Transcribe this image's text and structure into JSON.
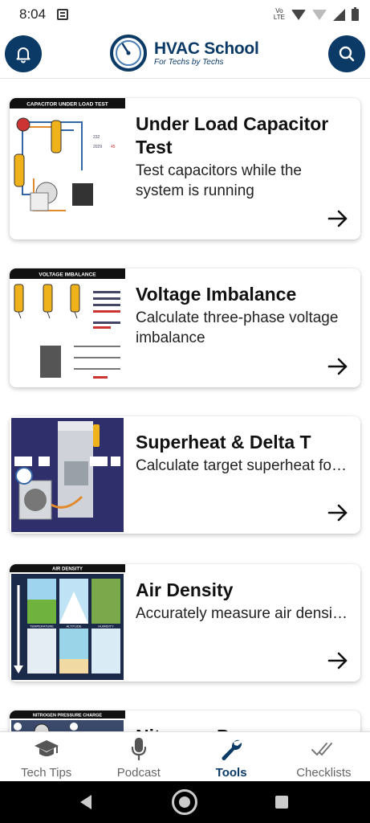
{
  "status_bar": {
    "time": "8:04",
    "network_top": "Vo",
    "network_bottom": "LTE"
  },
  "header": {
    "logo_title": "HVAC School",
    "logo_subtitle": "For Techs by Techs",
    "left_icon": "bell-icon",
    "right_icon": "search-icon",
    "brand_color": "#0b3a66"
  },
  "tools": [
    {
      "thumb_label": "CAPACITOR UNDER LOAD TEST",
      "title": "Under Load Capacitor Test",
      "description": "Test capacitors while the system is running"
    },
    {
      "thumb_label": "VOLTAGE IMBALANCE",
      "title": "Voltage Imbalance",
      "description": "Calculate three-phase voltage imbalance"
    },
    {
      "thumb_label": "",
      "title": "Superheat & Delta T",
      "description": "Calculate target superheat for fixed metering device (…"
    },
    {
      "thumb_label": "AIR DENSITY",
      "title": "Air Density",
      "description": "Accurately measure air density based on local altit…",
      "thumb_sublabels": [
        "TEMPERATURE",
        "ALTITUDE",
        "HUMIDITY"
      ]
    },
    {
      "thumb_label": "NITROGEN PRESSURE CHARGE",
      "title": "Nitrogen Pressure",
      "description": ""
    }
  ],
  "tabs": [
    {
      "label": "Tech Tips",
      "icon": "graduation-cap-icon",
      "active": false
    },
    {
      "label": "Podcast",
      "icon": "microphone-icon",
      "active": false
    },
    {
      "label": "Tools",
      "icon": "wrench-icon",
      "active": true
    },
    {
      "label": "Checklists",
      "icon": "double-check-icon",
      "active": false
    }
  ]
}
